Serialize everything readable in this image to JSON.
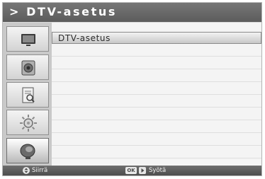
{
  "header": {
    "title": "> DTV-asetus"
  },
  "sidebar": {
    "items": [
      {
        "icon": "tv-icon"
      },
      {
        "icon": "speaker-icon"
      },
      {
        "icon": "document-search-icon"
      },
      {
        "icon": "settings-icon"
      },
      {
        "icon": "satellite-dish-icon",
        "selected": true
      }
    ]
  },
  "menu": {
    "rows": [
      {
        "label": "DTV-asetus",
        "selected": true
      },
      {
        "label": ""
      },
      {
        "label": ""
      },
      {
        "label": ""
      },
      {
        "label": ""
      },
      {
        "label": ""
      },
      {
        "label": ""
      },
      {
        "label": ""
      },
      {
        "label": ""
      },
      {
        "label": ""
      }
    ]
  },
  "footer": {
    "move_label": "Siirrä",
    "ok_key": "OK",
    "enter_label": "Syötä"
  },
  "colors": {
    "header_bg": "#666666",
    "sidebar_bg": "#c9c9c9",
    "content_bg": "#f4f4f4",
    "footer_bg": "#5a5a5a"
  }
}
